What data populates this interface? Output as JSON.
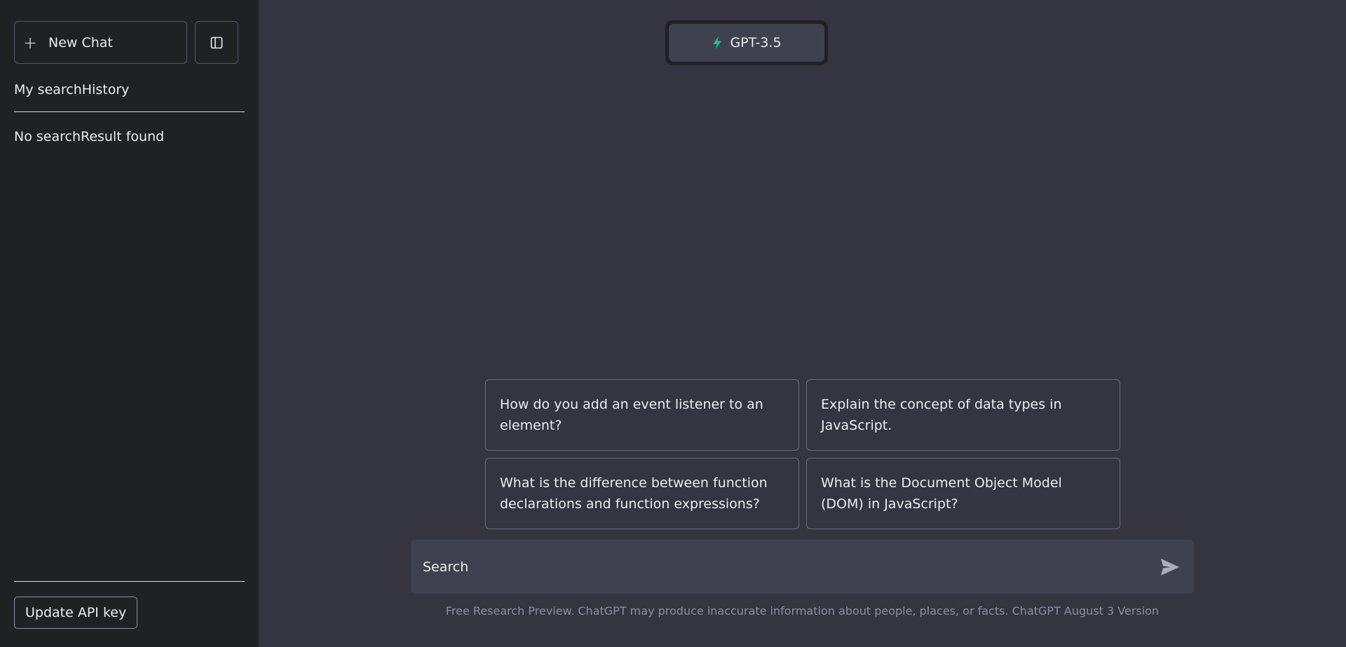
{
  "sidebar": {
    "new_chat_label": "New Chat",
    "history_title": "My searchHistory",
    "no_result_text": "No searchResult found",
    "update_api_label": "Update API key",
    "icons": {
      "new_chat": "plus-icon",
      "toggle": "sidebar-toggle-icon"
    }
  },
  "header": {
    "model_label": "GPT-3.5",
    "model_icon": "lightning-icon",
    "model_icon_color": "#19c37d"
  },
  "suggestions": [
    "How do you add an event listener to an element?",
    "Explain the concept of data types in JavaScript.",
    "What is the difference between function declarations and function expressions?",
    "What is the Document Object Model (DOM) in JavaScript?"
  ],
  "search": {
    "placeholder": "Search",
    "value": "",
    "send_icon": "send-icon"
  },
  "footer": {
    "disclaimer": "Free Research Preview. ChatGPT may produce inaccurate information about people, places, or facts. ChatGPT August 3 Version"
  },
  "colors": {
    "sidebar_bg": "#202123",
    "main_bg": "#343541",
    "input_bg": "#40414f",
    "accent": "#19c37d"
  }
}
